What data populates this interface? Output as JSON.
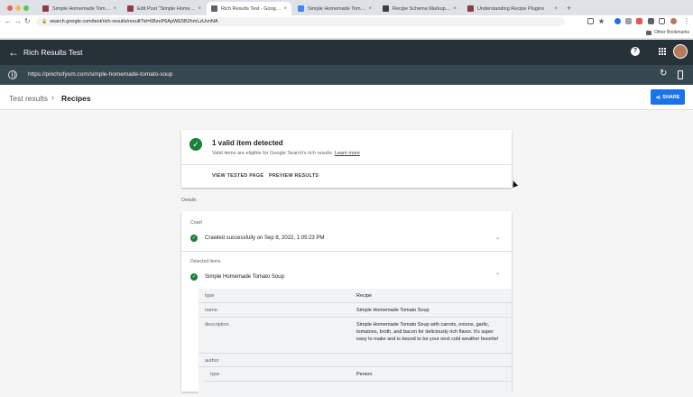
{
  "browser": {
    "tabs": [
      {
        "label": "Simple Homemade Tomato Sou",
        "favicon_color": "#8e3b46",
        "active": false
      },
      {
        "label": "Edit Post \"Simple Homemade",
        "favicon_color": "#8e3b46",
        "active": false
      },
      {
        "label": "Rich Results Test - Google Se",
        "favicon_color": "#5f6368",
        "active": true
      },
      {
        "label": "Simple Homemade Tomato So",
        "favicon_color": "#4285f4",
        "active": false
      },
      {
        "label": "Recipe Schema Markup | Dev",
        "favicon_color": "#3c4043",
        "active": false
      },
      {
        "label": "Understanding Recipe Plugins",
        "favicon_color": "#8e3b46",
        "active": false
      }
    ],
    "address": "search.google.com/test/rich-results/result?id=6BzeP6ApWE5B2hmLzUvnNA",
    "other_bookmarks": "Other Bookmarks"
  },
  "app": {
    "title": "Rich Results Test",
    "tested_url": "https://pinchofyum.com/simple-homemade-tomato-soup",
    "breadcrumb": {
      "root": "Test results",
      "current": "Recipes"
    },
    "share_label": "SHARE"
  },
  "summary": {
    "headline": "1 valid item detected",
    "subtext": "Valid items are eligible for Google Search's rich results.",
    "learn_more": "Learn more",
    "view_tested_page": "VIEW TESTED PAGE",
    "preview_results": "PREVIEW RESULTS"
  },
  "details": {
    "label": "Details",
    "crawl": {
      "label": "Crawl",
      "status": "Crawled successfully on Sep 8, 2022, 1:05:23 PM"
    },
    "detected": {
      "label": "Detected items",
      "item": "Simple Homemade Tomato Soup"
    },
    "rows": [
      {
        "key": "type",
        "value": "Recipe"
      },
      {
        "key": "name",
        "value": "Simple Homemade Tomato Soup"
      },
      {
        "key": "description",
        "value": "Simple Homemade Tomato Soup with carrots, onions, garlic, tomatoes, broth, and bacon for deliciously rich flavor. It's super easy to make and is bound to be your next cold weather favorite!"
      },
      {
        "key": "author",
        "value": ""
      },
      {
        "key": "type",
        "value": "Person"
      }
    ]
  },
  "colors": {
    "header_bg": "#263238",
    "url_bar_bg": "#37474f",
    "accent_blue": "#1a73e8",
    "success_green": "#188038"
  }
}
